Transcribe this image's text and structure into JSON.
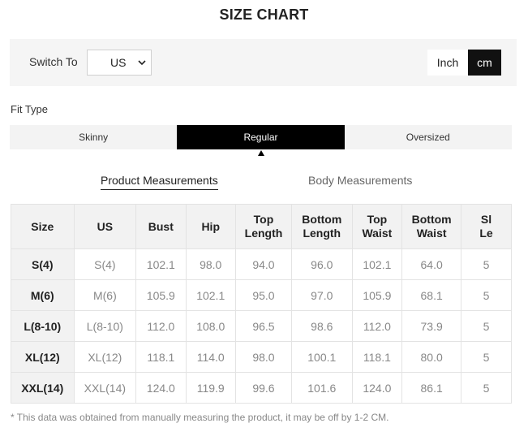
{
  "title": "SIZE CHART",
  "switch": {
    "label": "Switch To",
    "region_value": "US",
    "units": [
      "Inch",
      "cm"
    ],
    "active_unit": "cm"
  },
  "fit": {
    "label": "Fit Type",
    "tabs": [
      "Skinny",
      "Regular",
      "Oversized"
    ],
    "active": "Regular"
  },
  "measure_tabs": {
    "product": "Product Measurements",
    "body": "Body Measurements",
    "active": "product"
  },
  "table": {
    "headers": [
      "Size",
      "US",
      "Bust",
      "Hip",
      "Top\nLength",
      "Bottom\nLength",
      "Top\nWaist",
      "Bottom\nWaist",
      "Sl\nLe"
    ],
    "rows": [
      [
        "S(4)",
        "S(4)",
        "102.1",
        "98.0",
        "94.0",
        "96.0",
        "102.1",
        "64.0",
        "5"
      ],
      [
        "M(6)",
        "M(6)",
        "105.9",
        "102.1",
        "95.0",
        "97.0",
        "105.9",
        "68.1",
        "5"
      ],
      [
        "L(8-10)",
        "L(8-10)",
        "112.0",
        "108.0",
        "96.5",
        "98.6",
        "112.0",
        "73.9",
        "5"
      ],
      [
        "XL(12)",
        "XL(12)",
        "118.1",
        "114.0",
        "98.0",
        "100.1",
        "118.1",
        "80.0",
        "5"
      ],
      [
        "XXL(14)",
        "XXL(14)",
        "124.0",
        "119.9",
        "99.6",
        "101.6",
        "124.0",
        "86.1",
        "5"
      ]
    ]
  },
  "note": "* This data was obtained from manually measuring the product, it may be off by 1-2 CM.",
  "colors": {
    "active_bg": "#000000",
    "panel_bg": "#f5f5f5",
    "muted_text": "#888888"
  }
}
